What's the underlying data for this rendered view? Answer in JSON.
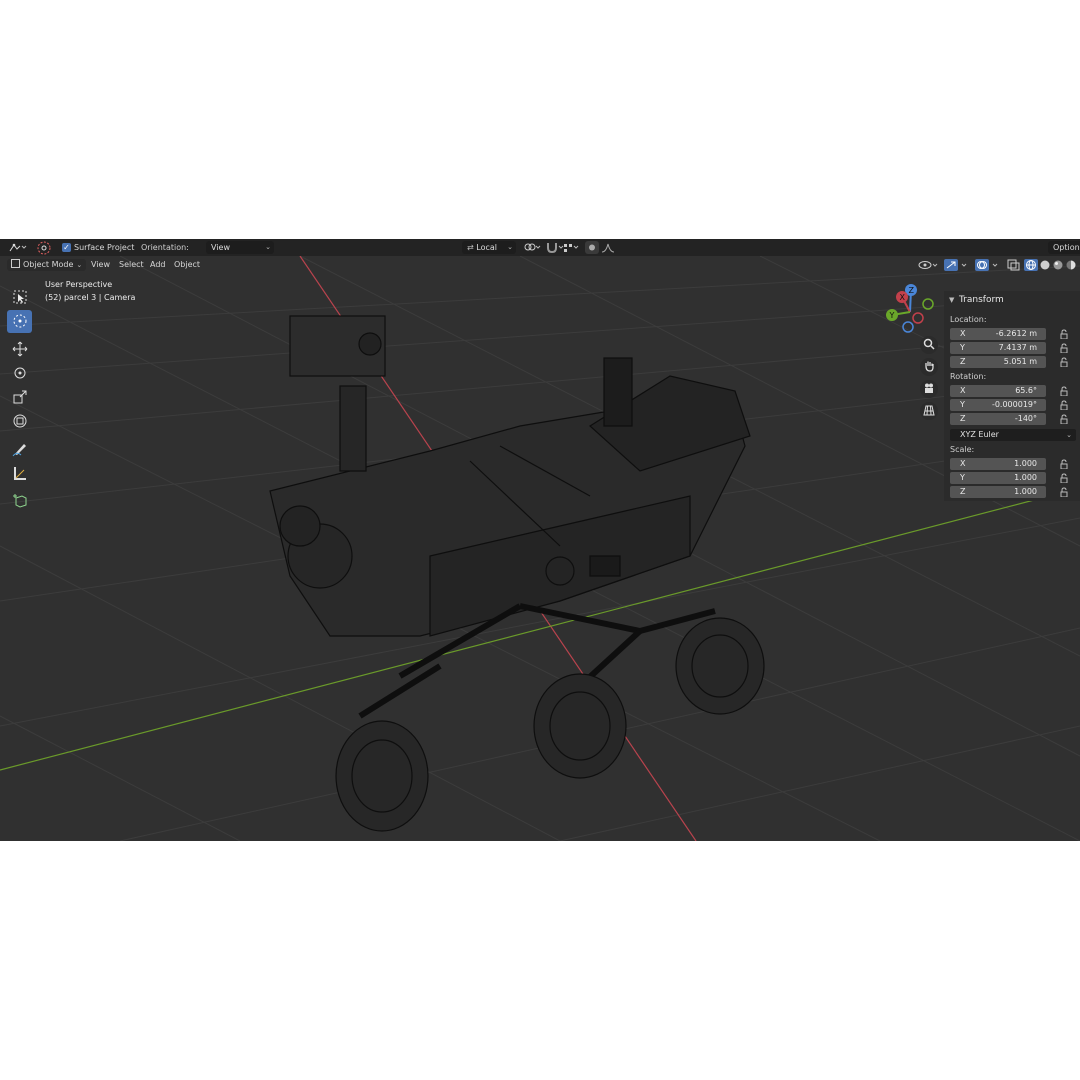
{
  "header": {
    "surface_project_label": "Surface Project",
    "orientation_label": "Orientation:",
    "orientation_value": "View",
    "pivot_value": "Local",
    "options_label": "Options"
  },
  "viewport_header": {
    "mode": "Object Mode",
    "menus": [
      "View",
      "Select",
      "Add",
      "Object"
    ]
  },
  "overlay": {
    "perspective": "User Perspective",
    "object_info": "(52) parcel 3 | Camera"
  },
  "gizmo": {
    "x": "X",
    "y": "Y",
    "z": "Z"
  },
  "sidebar": {
    "panel_title": "Transform",
    "location_label": "Location:",
    "location": [
      {
        "axis": "X",
        "value": "-6.2612 m"
      },
      {
        "axis": "Y",
        "value": "7.4137 m"
      },
      {
        "axis": "Z",
        "value": "5.051 m"
      }
    ],
    "rotation_label": "Rotation:",
    "rotation": [
      {
        "axis": "X",
        "value": "65.6°"
      },
      {
        "axis": "Y",
        "value": "-0.000019°"
      },
      {
        "axis": "Z",
        "value": "-140°"
      }
    ],
    "rotation_mode": "XYZ Euler",
    "scale_label": "Scale:",
    "scale": [
      {
        "axis": "X",
        "value": "1.000"
      },
      {
        "axis": "Y",
        "value": "1.000"
      },
      {
        "axis": "Z",
        "value": "1.000"
      }
    ]
  },
  "colors": {
    "accent": "#4772b3",
    "viewport_bg": "#303030",
    "header_bg": "#232323",
    "x_axis": "#c0444e",
    "y_axis": "#6a9a2a",
    "grid": "#3d3d3d",
    "wire": "#0c0c0c"
  },
  "icons": [
    "editor-type-icon",
    "cursor-tool-icon",
    "select-box-icon",
    "move-icon",
    "rotate-icon",
    "scale-icon",
    "transform-icon",
    "annotate-icon",
    "measure-icon",
    "add-cube-icon",
    "zoom-icon",
    "pan-hand-icon",
    "camera-view-icon",
    "grid-view-icon"
  ]
}
